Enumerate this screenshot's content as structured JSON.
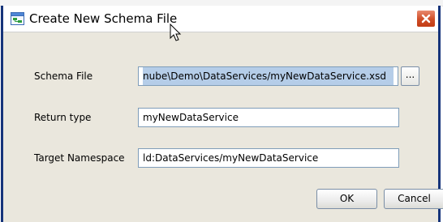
{
  "dialog": {
    "title": "Create New Schema File",
    "fields": {
      "schema_file": {
        "label": "Schema File",
        "value": "nube\\Demo\\DataServices/myNewDataService.xsd"
      },
      "return_type": {
        "label": "Return type",
        "value": "myNewDataService"
      },
      "target_namespace": {
        "label": "Target Namespace",
        "value": "ld:DataServices/myNewDataService"
      }
    },
    "browse_label": "...",
    "ok_label": "OK",
    "cancel_label": "Cancel"
  },
  "colors": {
    "frame": "#16347a",
    "dialog_bg": "#eae7dd",
    "selection": "#b5cde8",
    "close_button": "#cf4d26"
  },
  "icons": {
    "title": "schema-file-icon",
    "close": "close-icon",
    "cursor": "mouse-cursor-icon"
  }
}
